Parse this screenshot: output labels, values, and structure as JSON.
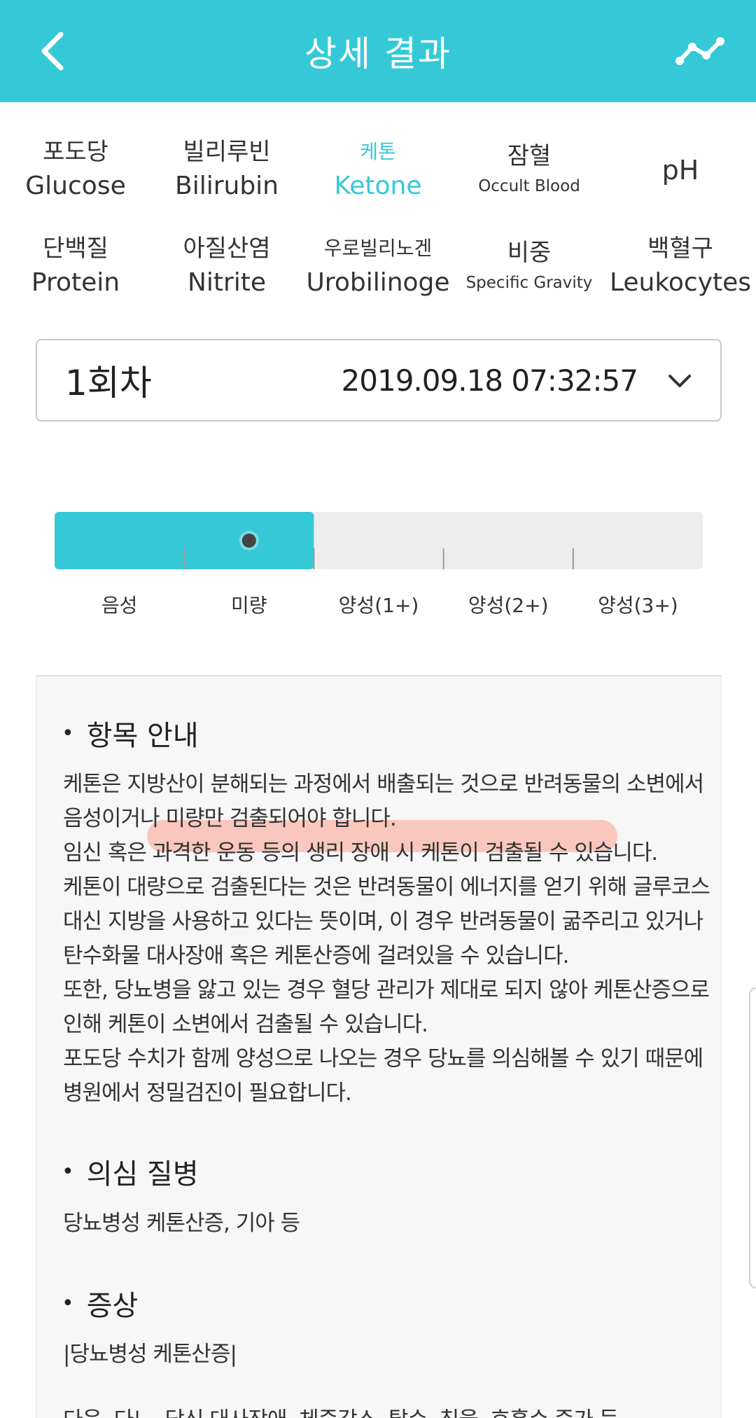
{
  "header": {
    "title": "상세 결과",
    "back_icon": "chevron-left-icon",
    "chart_icon": "trend-line-icon",
    "color": "#35c9d8"
  },
  "test_items": [
    {
      "ko": "포도당",
      "en": "Glucose",
      "active": false
    },
    {
      "ko": "빌리루빈",
      "en": "Bilirubin",
      "active": false
    },
    {
      "ko": "케톤",
      "en": "Ketone",
      "active": true
    },
    {
      "ko": "잠혈",
      "en": "Occult Blood",
      "active": false
    },
    {
      "ko": "",
      "en": "pH",
      "active": false
    },
    {
      "ko": "단백질",
      "en": "Protein",
      "active": false
    },
    {
      "ko": "아질산염",
      "en": "Nitrite",
      "active": false
    },
    {
      "ko": "우로빌리노겐",
      "en": "Urobilinoge",
      "active": false
    },
    {
      "ko": "비중",
      "en": "Specific Gravity",
      "active": false
    },
    {
      "ko": "백혈구",
      "en": "Leukocytes",
      "active": false
    }
  ],
  "session": {
    "label": "1회차",
    "datetime": "2019.09.18 07:32:57"
  },
  "scale": {
    "levels": [
      "음성",
      "미량",
      "양성(1+)",
      "양성(2+)",
      "양성(3+)"
    ],
    "result_level_index": 1,
    "filled_fraction": 0.4
  },
  "description": {
    "guide_title": "항목 안내",
    "guide_lines": [
      "케톤은 지방산이 분해되는 과정에서 배출되는 것으로 반려동물의 소변에서",
      "음성이거나 미량만 검출되어야 합니다.",
      "임신 혹은 과격한 운동 등의 생리 장애 시 케톤이 검출될 수 있습니다.",
      "케톤이 대량으로 검출된다는 것은 반려동물이 에너지를 얻기 위해 글루코스",
      "대신 지방을 사용하고 있다는 뜻이며, 이 경우 반려동물이 굶주리고 있거나",
      "탄수화물 대사장애 혹은 케톤산증에 걸려있을 수 있습니다.",
      "또한, 당뇨병을 앓고 있는 경우 혈당 관리가 제대로 되지 않아 케톤산증으로",
      "인해 케톤이 소변에서 검출될 수 있습니다.",
      "포도당 수치가 함께 양성으로 나오는 경우 당뇨를 의심해볼 수 있기 때문에",
      "병원에서 정밀검진이 필요합니다."
    ],
    "disease_title": "의심 질병",
    "disease_text": "당뇨병성 케톤산증, 기아 등",
    "symptom_title": "증상",
    "symptom_text": "|당뇨병성 케톤산증|",
    "symptom_cut_text": "다음, 다뇨, 당신 대사장애, 체중감소, 탈수, 침울, 호흡수 증가 등"
  }
}
